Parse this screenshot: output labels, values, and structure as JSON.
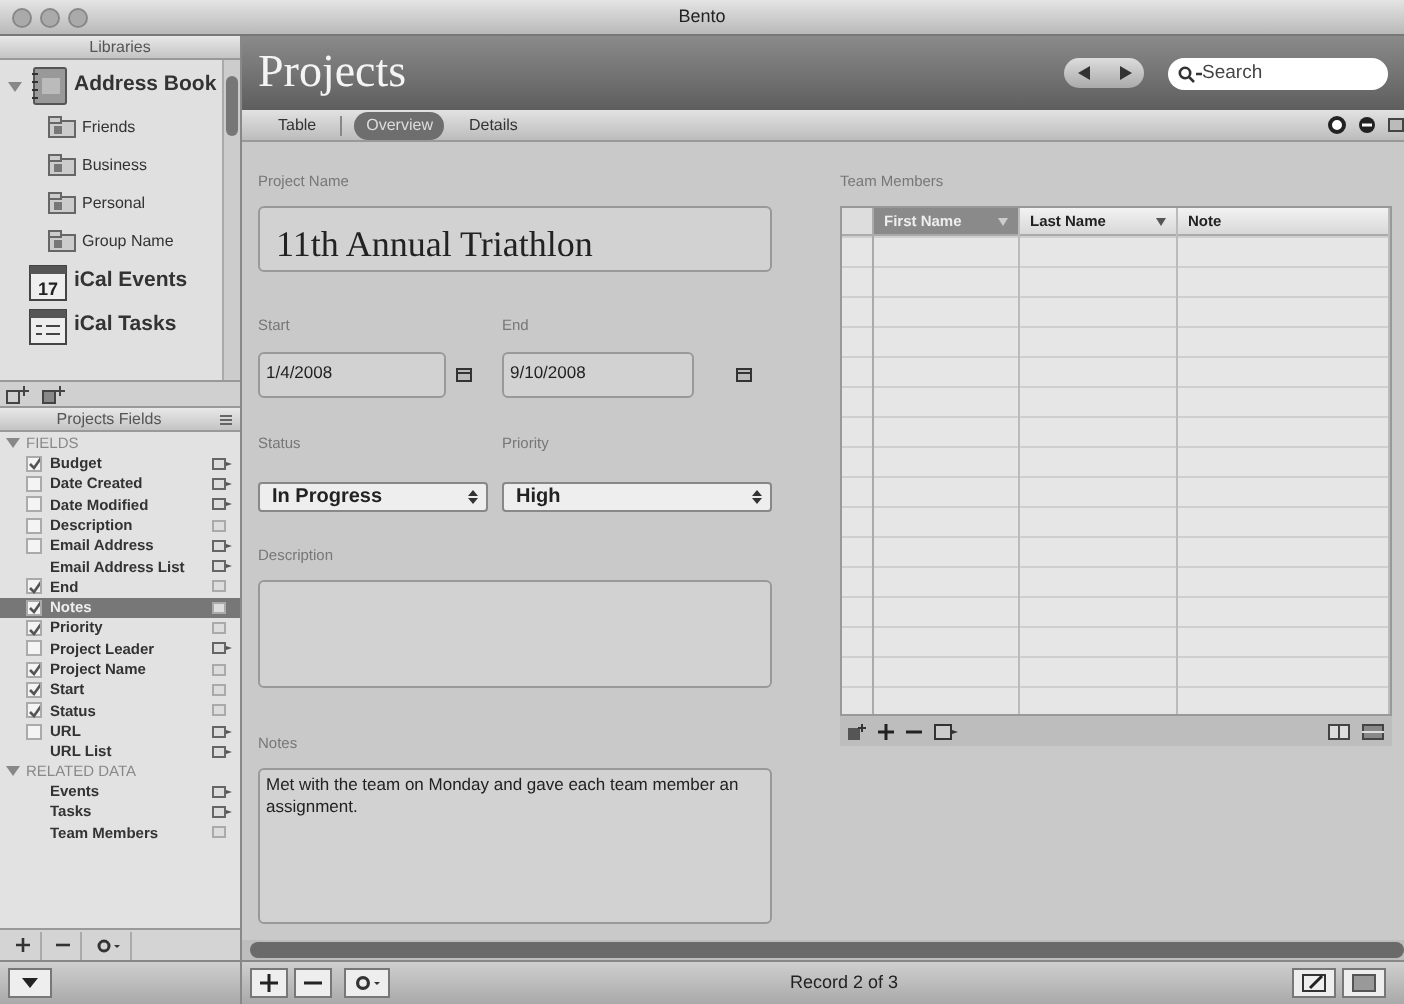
{
  "window": {
    "title": "Bento"
  },
  "sidebar": {
    "libraries_header": "Libraries",
    "libraries": [
      {
        "label": "Address Book",
        "kind": "address-book",
        "expanded": true,
        "children": [
          {
            "label": "Friends",
            "kind": "group"
          },
          {
            "label": "Business",
            "kind": "group"
          },
          {
            "label": "Personal",
            "kind": "group"
          },
          {
            "label": "Group Name",
            "kind": "group"
          }
        ]
      },
      {
        "label": "iCal Events",
        "kind": "calendar",
        "badge": "17"
      },
      {
        "label": "iCal Tasks",
        "kind": "tasks"
      }
    ],
    "fields_header": "Projects Fields",
    "field_groups": [
      {
        "label": "FIELDS",
        "expanded": true,
        "items": [
          {
            "label": "Budget",
            "kind": "checkbox",
            "checked": true,
            "linked": true,
            "selected": false
          },
          {
            "label": "Date Created",
            "kind": "checkbox",
            "checked": false,
            "linked": true,
            "selected": false
          },
          {
            "label": "Date Modified",
            "kind": "checkbox",
            "checked": false,
            "linked": true,
            "selected": false
          },
          {
            "label": "Description",
            "kind": "checkbox",
            "checked": false,
            "linked": false,
            "selected": false
          },
          {
            "label": "Email Address",
            "kind": "checkbox",
            "checked": false,
            "linked": true,
            "selected": false
          },
          {
            "label": "Email Address List",
            "kind": "plain",
            "linked": true,
            "selected": false
          },
          {
            "label": "End",
            "kind": "checkbox",
            "checked": true,
            "linked": false,
            "selected": false
          },
          {
            "label": "Notes",
            "kind": "checkbox",
            "checked": true,
            "linked": false,
            "selected": true
          },
          {
            "label": "Priority",
            "kind": "checkbox",
            "checked": true,
            "linked": false,
            "selected": false
          },
          {
            "label": "Project Leader",
            "kind": "checkbox",
            "checked": false,
            "linked": true,
            "selected": false
          },
          {
            "label": "Project Name",
            "kind": "checkbox",
            "checked": true,
            "linked": false,
            "selected": false
          },
          {
            "label": "Start",
            "kind": "checkbox",
            "checked": true,
            "linked": false,
            "selected": false
          },
          {
            "label": "Status",
            "kind": "checkbox",
            "checked": true,
            "linked": false,
            "selected": false
          },
          {
            "label": "URL",
            "kind": "checkbox",
            "checked": false,
            "linked": true,
            "selected": false
          },
          {
            "label": "URL List",
            "kind": "plain",
            "linked": true,
            "selected": false
          }
        ]
      },
      {
        "label": "RELATED DATA",
        "expanded": true,
        "items": [
          {
            "label": "Events",
            "kind": "plain",
            "linked": true,
            "selected": false
          },
          {
            "label": "Tasks",
            "kind": "plain",
            "linked": true,
            "selected": false
          },
          {
            "label": "Team Members",
            "kind": "plain",
            "linked": false,
            "selected": false
          }
        ]
      }
    ]
  },
  "main": {
    "title": "Projects",
    "search": {
      "placeholder": "Search"
    },
    "tabs": [
      {
        "label": "Table",
        "selected": false
      },
      {
        "label": "Overview",
        "selected": true
      },
      {
        "label": "Details",
        "selected": false
      }
    ],
    "form": {
      "project_name": {
        "label": "Project Name",
        "value": "11th Annual Triathlon"
      },
      "start": {
        "label": "Start",
        "value": "1/4/2008"
      },
      "end": {
        "label": "End",
        "value": "9/10/2008"
      },
      "status": {
        "label": "Status",
        "value": "In Progress"
      },
      "priority": {
        "label": "Priority",
        "value": "High"
      },
      "description": {
        "label": "Description"
      },
      "notes": {
        "label": "Notes",
        "value": "Met with the team on Monday and gave each team member an assignment."
      }
    },
    "team_members": {
      "label": "Team Members",
      "columns": [
        {
          "label": "First Name",
          "selected": true,
          "sortable": true
        },
        {
          "label": "Last Name",
          "selected": false,
          "sortable": true
        },
        {
          "label": "Note",
          "selected": false,
          "sortable": false
        }
      ]
    }
  },
  "status_bar": {
    "record": "Record 2 of 3"
  }
}
